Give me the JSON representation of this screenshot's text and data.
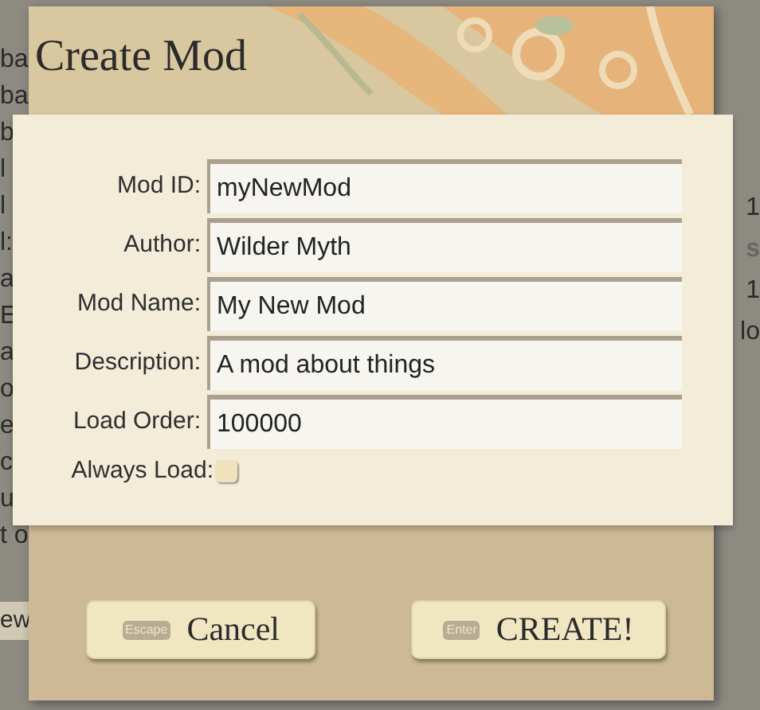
{
  "background": {
    "left_fragments": [
      "ba",
      "ba",
      "b",
      "l",
      "l",
      "l:",
      "a",
      "E",
      "a",
      "o",
      "e",
      "c",
      "u",
      "t o"
    ],
    "left_button": "ew",
    "right_fragments": [
      "1",
      "s",
      "1",
      "lo"
    ]
  },
  "dialog": {
    "title": "Create Mod",
    "fields": [
      {
        "label": "Mod ID:",
        "value": "myNewMod"
      },
      {
        "label": "Author:",
        "value": "Wilder Myth"
      },
      {
        "label": "Mod Name:",
        "value": "My New Mod"
      },
      {
        "label": "Description:",
        "value": "A mod about things"
      },
      {
        "label": "Load Order:",
        "value": "100000"
      }
    ],
    "checkbox": {
      "label": "Always Load:",
      "checked": false
    },
    "buttons": [
      {
        "key": "Escape",
        "label": "Cancel"
      },
      {
        "key": "Enter",
        "label": "CREATE!"
      }
    ]
  }
}
